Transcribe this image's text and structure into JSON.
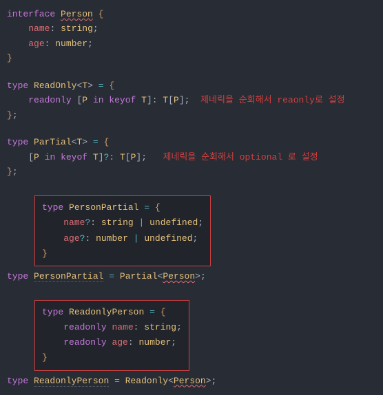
{
  "block1": {
    "l1_kw": "interface",
    "l1_name": "Person",
    "l2_prop": "name",
    "l2_type": "string",
    "l3_prop": "age",
    "l3_type": "number"
  },
  "block2": {
    "l1_kw": "type",
    "l1_name": "ReadOnly",
    "l1_generic": "T",
    "l2_readonly": "readonly",
    "l2_p": "P",
    "l2_in": "in",
    "l2_keyof": "keyof",
    "l2_t1": "T",
    "l2_t2": "T",
    "l2_p2": "P",
    "annotation": "제네릭을 순회해서 reaonly로 설정"
  },
  "block3": {
    "l1_kw": "type",
    "l1_name": "ParTial",
    "l1_generic": "T",
    "l2_p": "P",
    "l2_in": "in",
    "l2_keyof": "keyof",
    "l2_t1": "T",
    "l2_t2": "T",
    "l2_p2": "P",
    "annotation": "제네릭을 순회해서 optional 로 설정"
  },
  "tooltip1": {
    "l1_kw": "type",
    "l1_name": "PersonPartial",
    "l2_prop": "name",
    "l2_type": "string",
    "l2_undef": "undefined",
    "l3_prop": "age",
    "l3_type": "number",
    "l3_undef": "undefined"
  },
  "line_pp": {
    "kw": "type",
    "name": "PersonPartial",
    "partial": "Partial",
    "person": "Person"
  },
  "tooltip2": {
    "l1_kw": "type",
    "l1_name": "ReadonlyPerson",
    "l2_ro": "readonly",
    "l2_prop": "name",
    "l2_type": "string",
    "l3_ro": "readonly",
    "l3_prop": "age",
    "l3_type": "number"
  },
  "line_rp": {
    "kw": "type",
    "name": "ReadonlyPerson",
    "readonly": "Readonly",
    "person": "Person"
  }
}
